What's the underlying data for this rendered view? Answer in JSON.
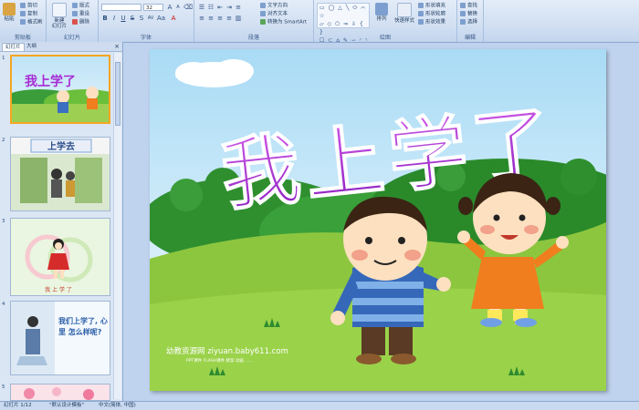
{
  "ribbon": {
    "clipboard": {
      "paste": "粘贴",
      "cut": "剪切",
      "copy": "复制",
      "format_painter": "格式刷",
      "label": "剪贴板"
    },
    "slides": {
      "new_slide": "新建\n幻灯片",
      "layout": "版式",
      "reset": "重设",
      "delete": "删除",
      "label": "幻灯片"
    },
    "font": {
      "font_name": "",
      "font_size": "32",
      "label": "字体"
    },
    "paragraph": {
      "text_direction": "文字方向",
      "align_text": "对齐文本",
      "smartart": "转换为 SmartArt",
      "label": "段落"
    },
    "drawing": {
      "arrange": "排列",
      "quick_styles": "快速样式",
      "shape_fill": "形状填充",
      "shape_outline": "形状轮廓",
      "shape_effects": "形状效果",
      "label": "绘图"
    },
    "editing": {
      "find": "查找",
      "replace": "替换",
      "select": "选择",
      "label": "编辑"
    }
  },
  "panel": {
    "tab_slides": "幻灯片",
    "tab_outline": "大纲",
    "close": "×"
  },
  "thumbnails": [
    {
      "num": "1",
      "title": "我上学了"
    },
    {
      "num": "2",
      "title": "上学去"
    },
    {
      "num": "3",
      "title": "我 上 学 了"
    },
    {
      "num": "4",
      "title": "我们上学了, 心里 怎么样呢?"
    },
    {
      "num": "5",
      "title": ""
    }
  ],
  "slide": {
    "title": "我上学了",
    "watermark_main": "幼教资源网 ziyuan.baby611.com",
    "watermark_sub": "PPT课件 FLASH课件 教案 动画 ......"
  },
  "status": {
    "slide_count": "幻灯片 1/12",
    "theme": "\"默认设计模板\"",
    "language": "中文(简体, 中国)"
  },
  "colors": {
    "title": "#a62bd4",
    "sky_top": "#bfe3f7",
    "grass": "#8cc63f",
    "accent": "#f5a623"
  }
}
